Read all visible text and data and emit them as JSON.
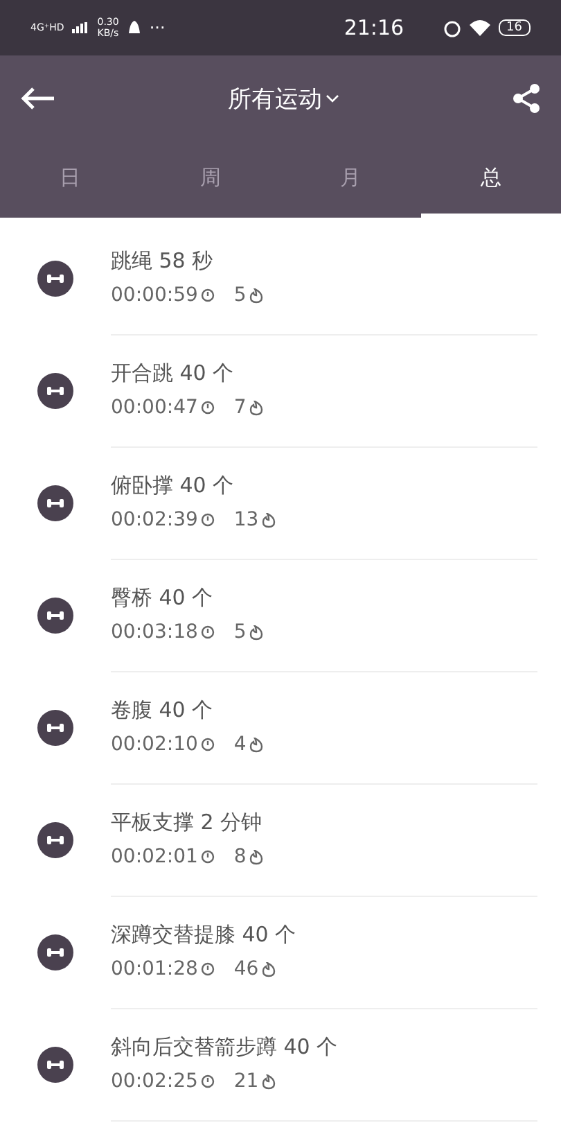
{
  "status_bar": {
    "network": "4G⁺HD",
    "speed": "0.30",
    "speed_unit": "KB/s",
    "more": "···",
    "time": "21:16",
    "battery": "16"
  },
  "header": {
    "title": "所有运动"
  },
  "tabs": [
    {
      "label": "日",
      "selected": false
    },
    {
      "label": "周",
      "selected": false
    },
    {
      "label": "月",
      "selected": false
    },
    {
      "label": "总",
      "selected": true
    }
  ],
  "workouts": [
    {
      "name": "跳绳 58 秒",
      "duration": "00:00:59",
      "calories": "5"
    },
    {
      "name": "开合跳 40 个",
      "duration": "00:00:47",
      "calories": "7"
    },
    {
      "name": "俯卧撑 40 个",
      "duration": "00:02:39",
      "calories": "13"
    },
    {
      "name": "臀桥 40 个",
      "duration": "00:03:18",
      "calories": "5"
    },
    {
      "name": "卷腹 40 个",
      "duration": "00:02:10",
      "calories": "4"
    },
    {
      "name": "平板支撑 2 分钟",
      "duration": "00:02:01",
      "calories": "8"
    },
    {
      "name": "深蹲交替提膝 40 个",
      "duration": "00:01:28",
      "calories": "46"
    },
    {
      "name": "斜向后交替箭步蹲 40 个",
      "duration": "00:02:25",
      "calories": "21"
    }
  ]
}
